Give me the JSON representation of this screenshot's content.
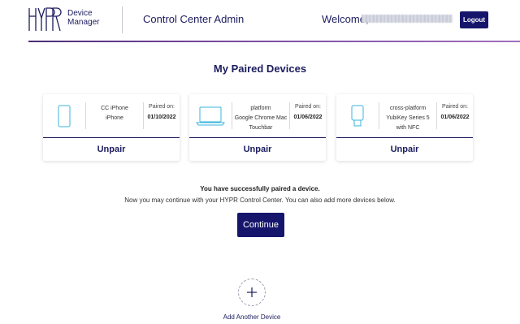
{
  "header": {
    "logo_text": "HYPR",
    "product_line1": "Device",
    "product_line2": "Manager",
    "title": "Control Center Admin",
    "welcome": "Welcome,",
    "logout_label": "Logout"
  },
  "main": {
    "title": "My Paired Devices",
    "cards": [
      {
        "icon": "phone-icon",
        "name_line1": "CC iPhone",
        "name_line2": "iPhone",
        "name_line3": "",
        "date_label": "Paired on:",
        "date": "01/10/2022",
        "unpair_label": "Unpair"
      },
      {
        "icon": "laptop-icon",
        "name_line1": "platform",
        "name_line2": "Google Chrome Mac",
        "name_line3": "Touchbar",
        "date_label": "Paired on:",
        "date": "01/06/2022",
        "unpair_label": "Unpair"
      },
      {
        "icon": "security-key-icon",
        "name_line1": "cross-platform",
        "name_line2": "YubiKey Series 5",
        "name_line3": "with NFC",
        "date_label": "Paired on:",
        "date": "01/06/2022",
        "unpair_label": "Unpair"
      }
    ],
    "success_title": "You have successfully paired a device.",
    "success_text": "Now you may continue with your HYPR Control Center. You can also add more devices below.",
    "continue_label": "Continue",
    "add_label": "Add Another Device"
  },
  "colors": {
    "navy": "#1b1c5e",
    "button": "#15166b",
    "icon_cyan": "#3ab4dc"
  }
}
